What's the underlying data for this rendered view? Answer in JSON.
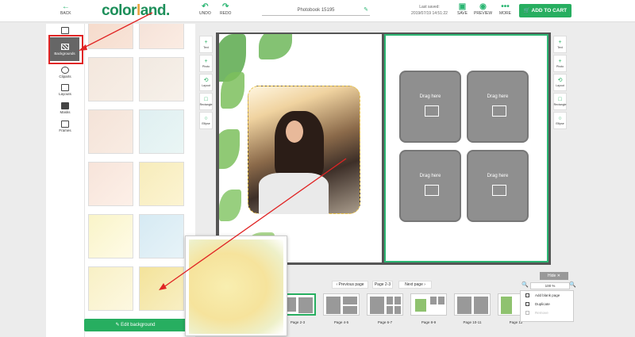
{
  "topbar": {
    "back_label": "BACK",
    "logo_a": "color",
    "logo_b": "l",
    "logo_c": "and.",
    "undo_label": "UNDO",
    "redo_label": "REDO",
    "title": "Photobook 15195",
    "last_saved_label": "Last saved:",
    "last_saved_time": "2019/07/19 14:51:22",
    "save_label": "SAVE",
    "preview_label": "PREVIEW",
    "more_label": "MORE",
    "cart_label": "ADD TO CART"
  },
  "rail": {
    "items": [
      {
        "label": "Backgrounds",
        "icon": "backgrounds-icon"
      },
      {
        "label": "Cliparts",
        "icon": "cliparts-icon"
      },
      {
        "label": "Layouts",
        "icon": "layouts-icon"
      },
      {
        "label": "Masks",
        "icon": "masks-icon"
      },
      {
        "label": "Frames",
        "icon": "frames-icon"
      }
    ]
  },
  "bgpanel": {
    "edit_label": "Edit background",
    "thumbs": [
      {
        "color_a": "#f5d9c9",
        "color_b": "#f8e4d8"
      },
      {
        "color_a": "#f4e0d6",
        "color_b": "#fbece3"
      },
      {
        "color_a": "#f3e7dd",
        "color_b": "#f7eee6"
      },
      {
        "color_a": "#f1e9e1",
        "color_b": "#f7f1ea"
      },
      {
        "color_a": "#f4e3d8",
        "color_b": "#f9ece3"
      },
      {
        "color_a": "#dfeff1",
        "color_b": "#eaf6f5"
      },
      {
        "color_a": "#f7e4da",
        "color_b": "#fdf0e8"
      },
      {
        "color_a": "#f7ecbb",
        "color_b": "#fcf4d2"
      },
      {
        "color_a": "#f9f4c8",
        "color_b": "#fffbe7"
      },
      {
        "color_a": "#d6eaf3",
        "color_b": "#e7f3f8"
      },
      {
        "color_a": "#f8f0c5",
        "color_b": "#fdf8e1"
      },
      {
        "color_a": "#f4e39a",
        "color_b": "#f8efc4"
      }
    ]
  },
  "side_tools": [
    {
      "label": "Text",
      "glyph": "+"
    },
    {
      "label": "Photo",
      "glyph": "+"
    },
    {
      "label": "Layout",
      "glyph": "⟲"
    },
    {
      "label": "Rectangle",
      "glyph": "□"
    },
    {
      "label": "Ellipse",
      "glyph": "○"
    }
  ],
  "slots": {
    "label": "Drag here"
  },
  "zoom": {
    "hide_label": "Hide",
    "level": "100 %"
  },
  "pagebar": {
    "prev_label": "Previous page",
    "current": "Page 2-3",
    "next_label": "Next page"
  },
  "strip": {
    "pages": [
      "Page 2-3",
      "Page 4-5",
      "Page 6-7",
      "Page 8-9",
      "Page 10-11",
      "Page 12"
    ]
  },
  "context_menu": {
    "items": [
      "Add blank page",
      "Duplicate",
      "Remove"
    ]
  },
  "colors": {
    "accent": "#27ae60",
    "annotation_red": "#e02424"
  }
}
